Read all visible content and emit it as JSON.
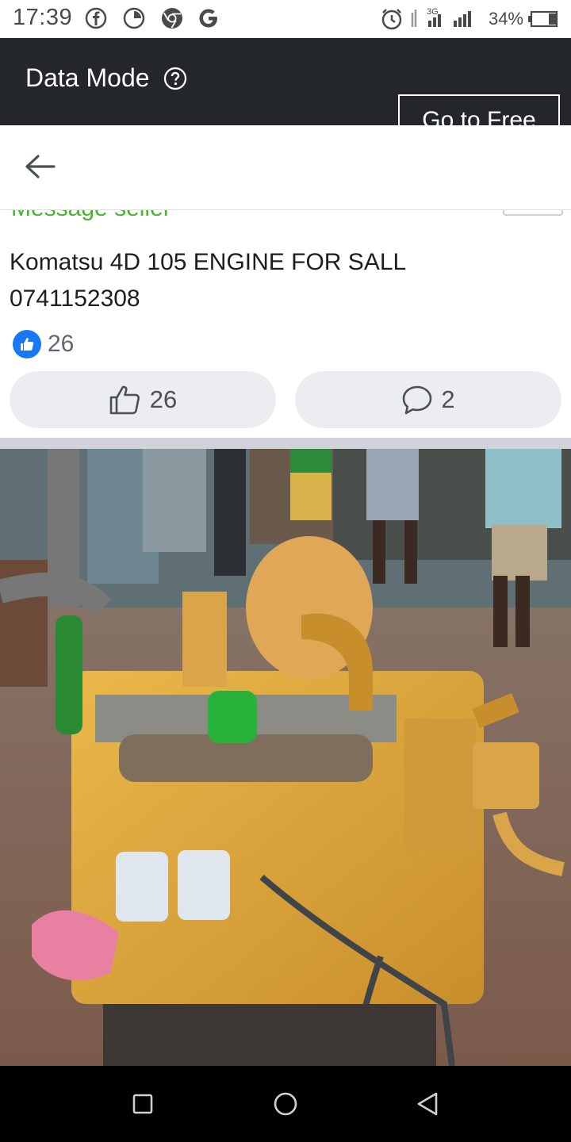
{
  "status_bar": {
    "time": "17:39",
    "network": "3G",
    "battery": "34%"
  },
  "data_mode": {
    "title": "Data Mode",
    "go_free_label": "Go to Free"
  },
  "post": {
    "message_seller": "Message seller",
    "text_line1": "Komatsu 4D 105 ENGINE FOR SALL",
    "text_line2": "0741152308",
    "reaction_count": "26",
    "like_count": "26",
    "comment_count": "2"
  },
  "colors": {
    "data_bar": "#23262b",
    "accent_green": "#42b72a",
    "like_blue": "#1877f2",
    "pill_bg": "#ebedf0"
  },
  "icons": [
    "facebook-icon",
    "clock-icon",
    "chrome-icon",
    "google-icon",
    "alarm-icon",
    "signal-icon",
    "battery-icon",
    "help-icon",
    "back-arrow-icon",
    "thumbs-up-icon",
    "comment-icon",
    "recent-apps-icon",
    "home-icon",
    "back-nav-icon"
  ]
}
